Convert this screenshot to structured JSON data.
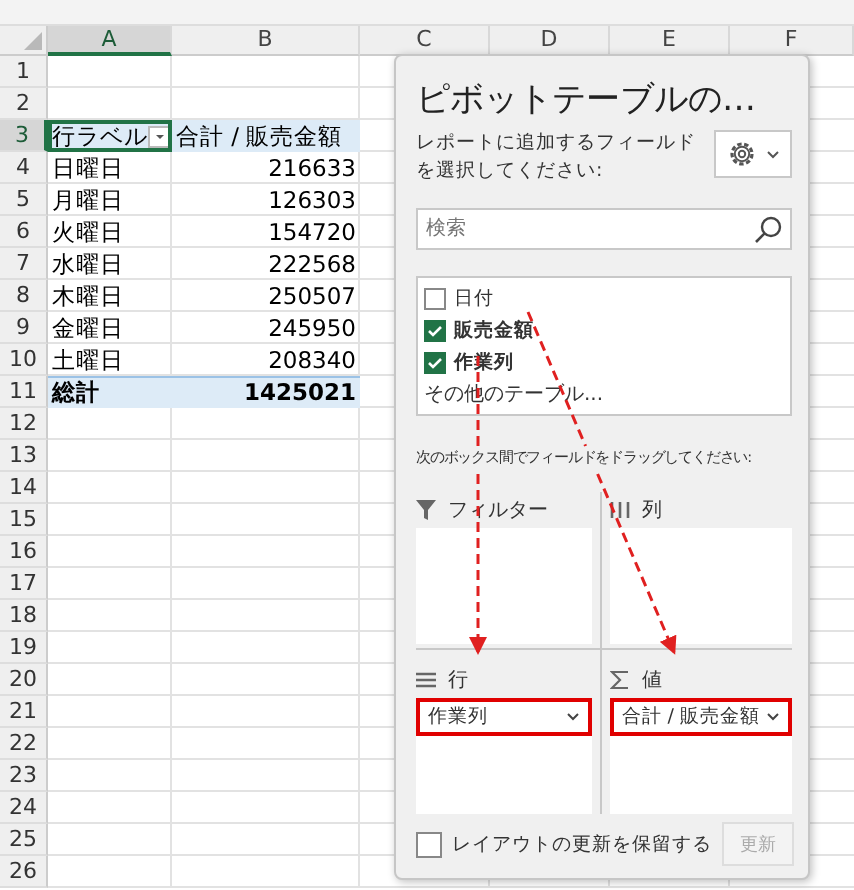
{
  "sheet": {
    "columns": [
      {
        "label": "A",
        "selected": true
      },
      {
        "label": "B",
        "selected": false
      },
      {
        "label": "C",
        "selected": false
      },
      {
        "label": "D",
        "selected": false
      },
      {
        "label": "E",
        "selected": false
      },
      {
        "label": "F",
        "selected": false
      }
    ],
    "rows": [
      {
        "label": "1",
        "selected": false,
        "kind": "plain"
      },
      {
        "label": "2",
        "selected": false,
        "kind": "plain"
      },
      {
        "label": "3",
        "selected": true,
        "kind": "pivot_header",
        "cells": [
          "行ラベル",
          "合計 / 販売金額"
        ]
      },
      {
        "label": "4",
        "selected": false,
        "kind": "pivot_item",
        "cells": [
          "日曜日",
          "216633"
        ]
      },
      {
        "label": "5",
        "selected": false,
        "kind": "pivot_item",
        "cells": [
          "月曜日",
          "126303"
        ]
      },
      {
        "label": "6",
        "selected": false,
        "kind": "pivot_item",
        "cells": [
          "火曜日",
          "154720"
        ]
      },
      {
        "label": "7",
        "selected": false,
        "kind": "pivot_item",
        "cells": [
          "水曜日",
          "222568"
        ]
      },
      {
        "label": "8",
        "selected": false,
        "kind": "pivot_item",
        "cells": [
          "木曜日",
          "250507"
        ]
      },
      {
        "label": "9",
        "selected": false,
        "kind": "pivot_item",
        "cells": [
          "金曜日",
          "245950"
        ]
      },
      {
        "label": "10",
        "selected": false,
        "kind": "pivot_item",
        "cells": [
          "土曜日",
          "208340"
        ]
      },
      {
        "label": "11",
        "selected": false,
        "kind": "pivot_total",
        "cells": [
          "総計",
          "1425021"
        ]
      },
      {
        "label": "12",
        "selected": false,
        "kind": "plain"
      },
      {
        "label": "13",
        "selected": false,
        "kind": "plain"
      },
      {
        "label": "14",
        "selected": false,
        "kind": "plain"
      },
      {
        "label": "15",
        "selected": false,
        "kind": "plain"
      },
      {
        "label": "16",
        "selected": false,
        "kind": "plain"
      },
      {
        "label": "17",
        "selected": false,
        "kind": "plain"
      },
      {
        "label": "18",
        "selected": false,
        "kind": "plain"
      },
      {
        "label": "19",
        "selected": false,
        "kind": "plain"
      },
      {
        "label": "20",
        "selected": false,
        "kind": "plain"
      },
      {
        "label": "21",
        "selected": false,
        "kind": "plain"
      },
      {
        "label": "22",
        "selected": false,
        "kind": "plain"
      },
      {
        "label": "23",
        "selected": false,
        "kind": "plain"
      },
      {
        "label": "24",
        "selected": false,
        "kind": "plain"
      },
      {
        "label": "25",
        "selected": false,
        "kind": "plain"
      },
      {
        "label": "26",
        "selected": false,
        "kind": "plain"
      }
    ]
  },
  "pivot_panel": {
    "title": "ピボットテーブルの…",
    "instruction": "レポートに追加するフィールドを選択してください:",
    "search": {
      "placeholder": "検索"
    },
    "fields": [
      {
        "label": "日付",
        "checked": false
      },
      {
        "label": "販売金額",
        "checked": true
      },
      {
        "label": "作業列",
        "checked": true
      }
    ],
    "more_tables": "その他のテーブル...",
    "drag_hint": "次のボックス間でフィールドをドラッグしてください:",
    "areas": [
      {
        "kind": "filter",
        "label": "フィルター"
      },
      {
        "kind": "columns",
        "label": "列"
      },
      {
        "kind": "rows",
        "label": "行",
        "items": [
          {
            "label": "作業列",
            "highlighted": true
          }
        ]
      },
      {
        "kind": "values",
        "label": "値",
        "items": [
          {
            "label": "合計 / 販売金額",
            "highlighted": true
          }
        ]
      }
    ],
    "defer": {
      "label": "レイアウトの更新を保留する",
      "checked": false
    },
    "update_button": {
      "label": "更新",
      "disabled": true
    }
  }
}
